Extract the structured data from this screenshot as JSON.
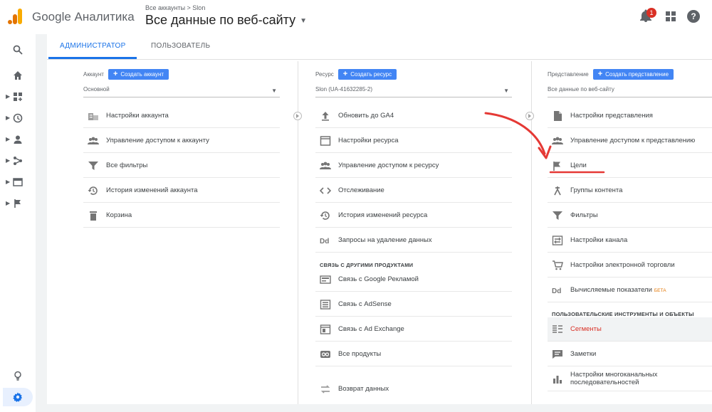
{
  "app": {
    "name": "Google Аналитика"
  },
  "header": {
    "breadcrumb": "Все аккаунты > Slon",
    "view_title": "Все данные по веб-сайту",
    "notifications_count": "1"
  },
  "tabs": [
    {
      "label": "АДМИНИСТРАТОР",
      "active": true
    },
    {
      "label": "ПОЛЬЗОВАТЕЛЬ",
      "active": false
    }
  ],
  "account": {
    "label": "Аккаунт",
    "create_label": "Создать аккаунт",
    "selected": "Основной",
    "items": [
      {
        "label": "Настройки аккаунта",
        "icon": "building-icon"
      },
      {
        "label": "Управление доступом к аккаунту",
        "icon": "people-icon"
      },
      {
        "label": "Все фильтры",
        "icon": "filter-icon"
      },
      {
        "label": "История изменений аккаунта",
        "icon": "history-icon"
      },
      {
        "label": "Корзина",
        "icon": "trash-icon"
      }
    ]
  },
  "property": {
    "label": "Ресурс",
    "create_label": "Создать ресурс",
    "selected": "Slon (UA-41632285-2)",
    "items": [
      {
        "label": "Обновить до GA4",
        "icon": "upload-icon"
      },
      {
        "label": "Настройки ресурса",
        "icon": "window-icon"
      },
      {
        "label": "Управление доступом к ресурсу",
        "icon": "people-icon"
      },
      {
        "label": "Отслеживание",
        "icon": "code-icon"
      },
      {
        "label": "История изменений ресурса",
        "icon": "history-icon"
      },
      {
        "label": "Запросы на удаление данных",
        "icon": "dd-icon"
      }
    ],
    "links_section": "СВЯЗЬ С ДРУГИМИ ПРОДУКТАМИ",
    "links": [
      {
        "label": "Связь с Google Рекламой",
        "icon": "ads-icon"
      },
      {
        "label": "Связь с AdSense",
        "icon": "adsense-icon"
      },
      {
        "label": "Связь с Ad Exchange",
        "icon": "adexchange-icon"
      },
      {
        "label": "Все продукты",
        "icon": "link-icon"
      }
    ],
    "extra": {
      "label": "Возврат данных",
      "icon": "return-icon"
    }
  },
  "view": {
    "label": "Представление",
    "create_label": "Создать представление",
    "selected": "Все данные по веб-сайту",
    "items": [
      {
        "label": "Настройки представления",
        "icon": "document-icon"
      },
      {
        "label": "Управление доступом к представлению",
        "icon": "people-icon"
      },
      {
        "label": "Цели",
        "icon": "flag-icon"
      },
      {
        "label": "Группы контента",
        "icon": "content-group-icon"
      },
      {
        "label": "Фильтры",
        "icon": "filter-icon"
      },
      {
        "label": "Настройки канала",
        "icon": "channel-icon"
      },
      {
        "label": "Настройки электронной торговли",
        "icon": "cart-icon"
      },
      {
        "label": "Вычисляемые показатели",
        "icon": "dd-icon",
        "badge": "БЕТА"
      }
    ],
    "tools_section": "ПОЛЬЗОВАТЕЛЬСКИЕ ИНСТРУМЕНТЫ И ОБЪЕКТЫ",
    "tools": [
      {
        "label": "Сегменты",
        "icon": "segments-icon"
      },
      {
        "label": "Заметки",
        "icon": "notes-icon"
      },
      {
        "label": "Настройки многоканальных последовательностей",
        "icon": "bar-chart-icon"
      }
    ]
  },
  "colors": {
    "accent": "#1a73e8",
    "button": "#4285f4",
    "alert": "#d93025",
    "annotation": "#e53935"
  }
}
